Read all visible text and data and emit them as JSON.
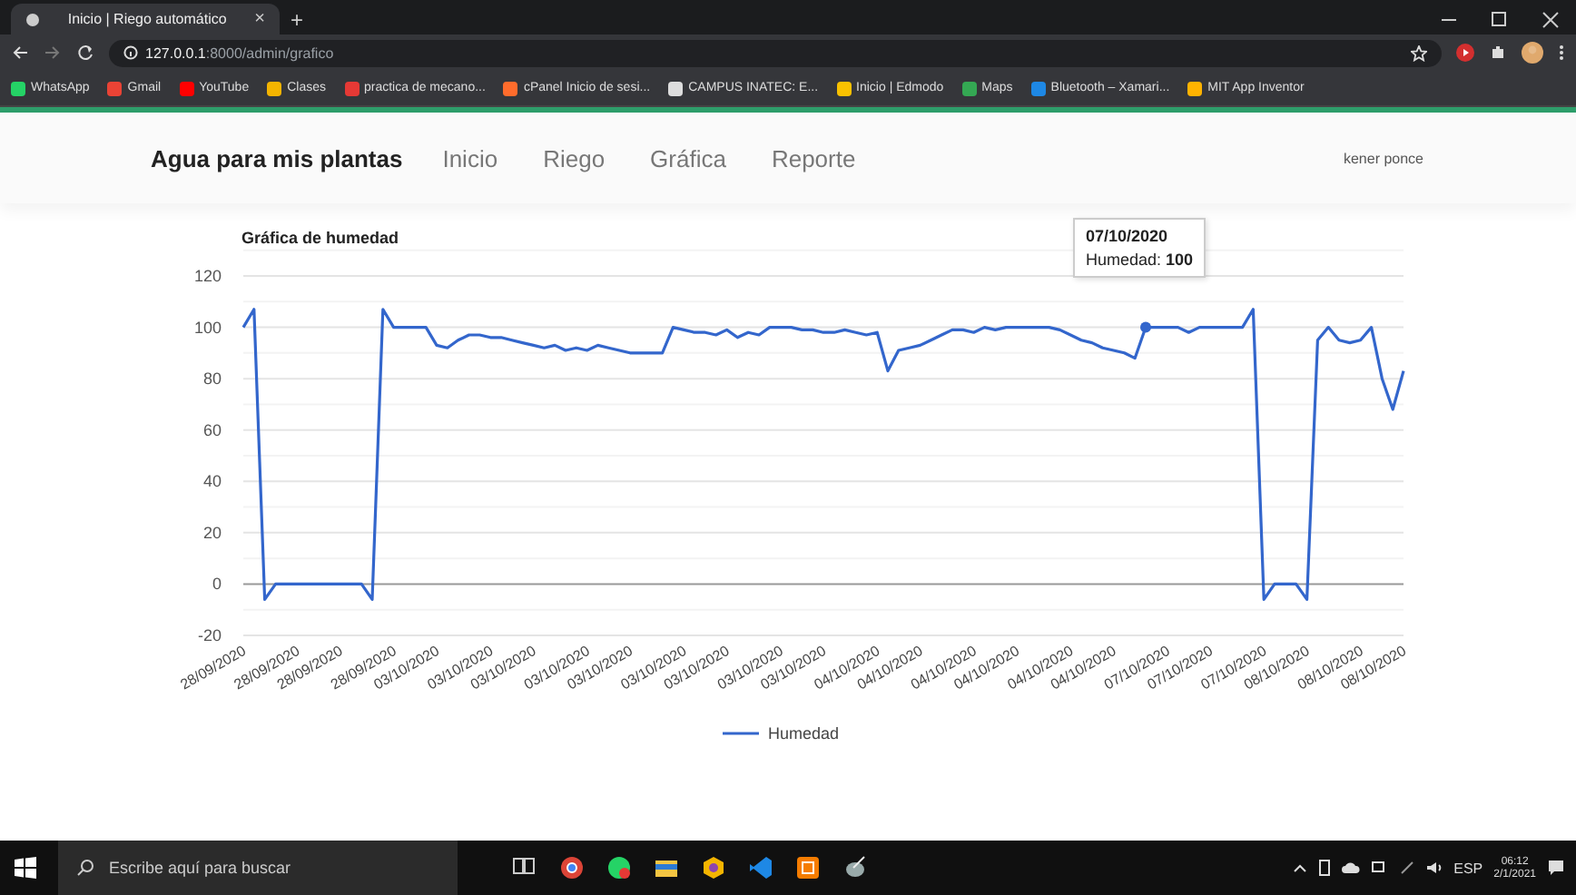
{
  "browser": {
    "tab_title": "Inicio | Riego automático",
    "tab_close": "×",
    "new_tab": "+",
    "url_host": "127.0.0.1",
    "url_path": ":8000/admin/grafico",
    "bookmarks": [
      {
        "label": "WhatsApp",
        "color": "#25d366"
      },
      {
        "label": "Gmail",
        "color": "#ea4335"
      },
      {
        "label": "YouTube",
        "color": "#ff0000"
      },
      {
        "label": "Clases",
        "color": "#f4b400"
      },
      {
        "label": "practica de mecano...",
        "color": "#e53935"
      },
      {
        "label": "cPanel Inicio de sesi...",
        "color": "#ff6c2c"
      },
      {
        "label": "CAMPUS INATEC: E...",
        "color": "#dddddd"
      },
      {
        "label": "Inicio | Edmodo",
        "color": "#f9c100"
      },
      {
        "label": "Maps",
        "color": "#34a853"
      },
      {
        "label": "Bluetooth – Xamari...",
        "color": "#1e88e5"
      },
      {
        "label": "MIT App Inventor",
        "color": "#ffb300"
      }
    ]
  },
  "nav": {
    "brand": "Agua para mis plantas",
    "items": [
      {
        "label": "Inicio"
      },
      {
        "label": "Riego"
      },
      {
        "label": "Gráfica"
      },
      {
        "label": "Reporte"
      }
    ],
    "user": "kener ponce"
  },
  "chart": {
    "chart_data": {
      "type": "line",
      "title": "Gráfica de humedad",
      "categories": [
        "28/09/2020",
        null,
        null,
        null,
        null,
        "28/09/2020",
        null,
        null,
        null,
        "28/09/2020",
        null,
        null,
        null,
        null,
        "28/09/2020",
        null,
        null,
        null,
        "03/10/2020",
        null,
        null,
        null,
        null,
        "03/10/2020",
        null,
        null,
        null,
        "03/10/2020",
        null,
        null,
        null,
        null,
        "03/10/2020",
        null,
        null,
        null,
        "03/10/2020",
        null,
        null,
        null,
        null,
        "03/10/2020",
        null,
        null,
        null,
        "03/10/2020",
        null,
        null,
        null,
        null,
        "03/10/2020",
        null,
        null,
        null,
        "03/10/2020",
        null,
        null,
        null,
        null,
        "04/10/2020",
        null,
        null,
        null,
        "04/10/2020",
        null,
        null,
        null,
        null,
        "04/10/2020",
        null,
        null,
        null,
        "04/10/2020",
        null,
        null,
        null,
        null,
        "04/10/2020",
        null,
        null,
        null,
        "04/10/2020",
        null,
        null,
        null,
        null,
        "07/10/2020",
        null,
        null,
        null,
        "07/10/2020",
        null,
        null,
        null,
        null,
        "07/10/2020",
        null,
        null,
        null,
        "08/10/2020",
        null,
        null,
        null,
        null,
        "08/10/2020",
        null,
        null,
        null,
        "08/10/2020"
      ],
      "series": [
        {
          "name": "Humedad",
          "color": "#3366cc",
          "values": [
            100,
            107,
            -6,
            0,
            0,
            0,
            0,
            0,
            0,
            0,
            0,
            0,
            -6,
            107,
            100,
            100,
            100,
            100,
            93,
            92,
            95,
            97,
            97,
            96,
            96,
            95,
            94,
            93,
            92,
            93,
            91,
            92,
            91,
            93,
            92,
            91,
            90,
            90,
            90,
            90,
            100,
            99,
            98,
            98,
            97,
            99,
            96,
            98,
            97,
            100,
            100,
            100,
            99,
            99,
            98,
            98,
            99,
            98,
            97,
            98,
            83,
            91,
            92,
            93,
            95,
            97,
            99,
            99,
            98,
            100,
            99,
            100,
            100,
            100,
            100,
            100,
            99,
            97,
            95,
            94,
            92,
            91,
            90,
            88,
            100,
            100,
            100,
            100,
            98,
            100,
            100,
            100,
            100,
            100,
            107,
            -6,
            0,
            0,
            0,
            -6,
            95,
            100,
            95,
            94,
            95,
            100,
            80,
            68,
            83
          ]
        }
      ],
      "ylim": [
        -20,
        120
      ],
      "grid": true,
      "yticks": [
        -20,
        0,
        20,
        40,
        60,
        80,
        100,
        120
      ]
    },
    "tooltip": {
      "date": "07/10/2020",
      "text": "Humedad: **100**"
    }
  },
  "taskbar": {
    "search_placeholder": "Escribe aquí para buscar",
    "language": "ESP",
    "time": "06:12",
    "date": "2/1/2021"
  }
}
